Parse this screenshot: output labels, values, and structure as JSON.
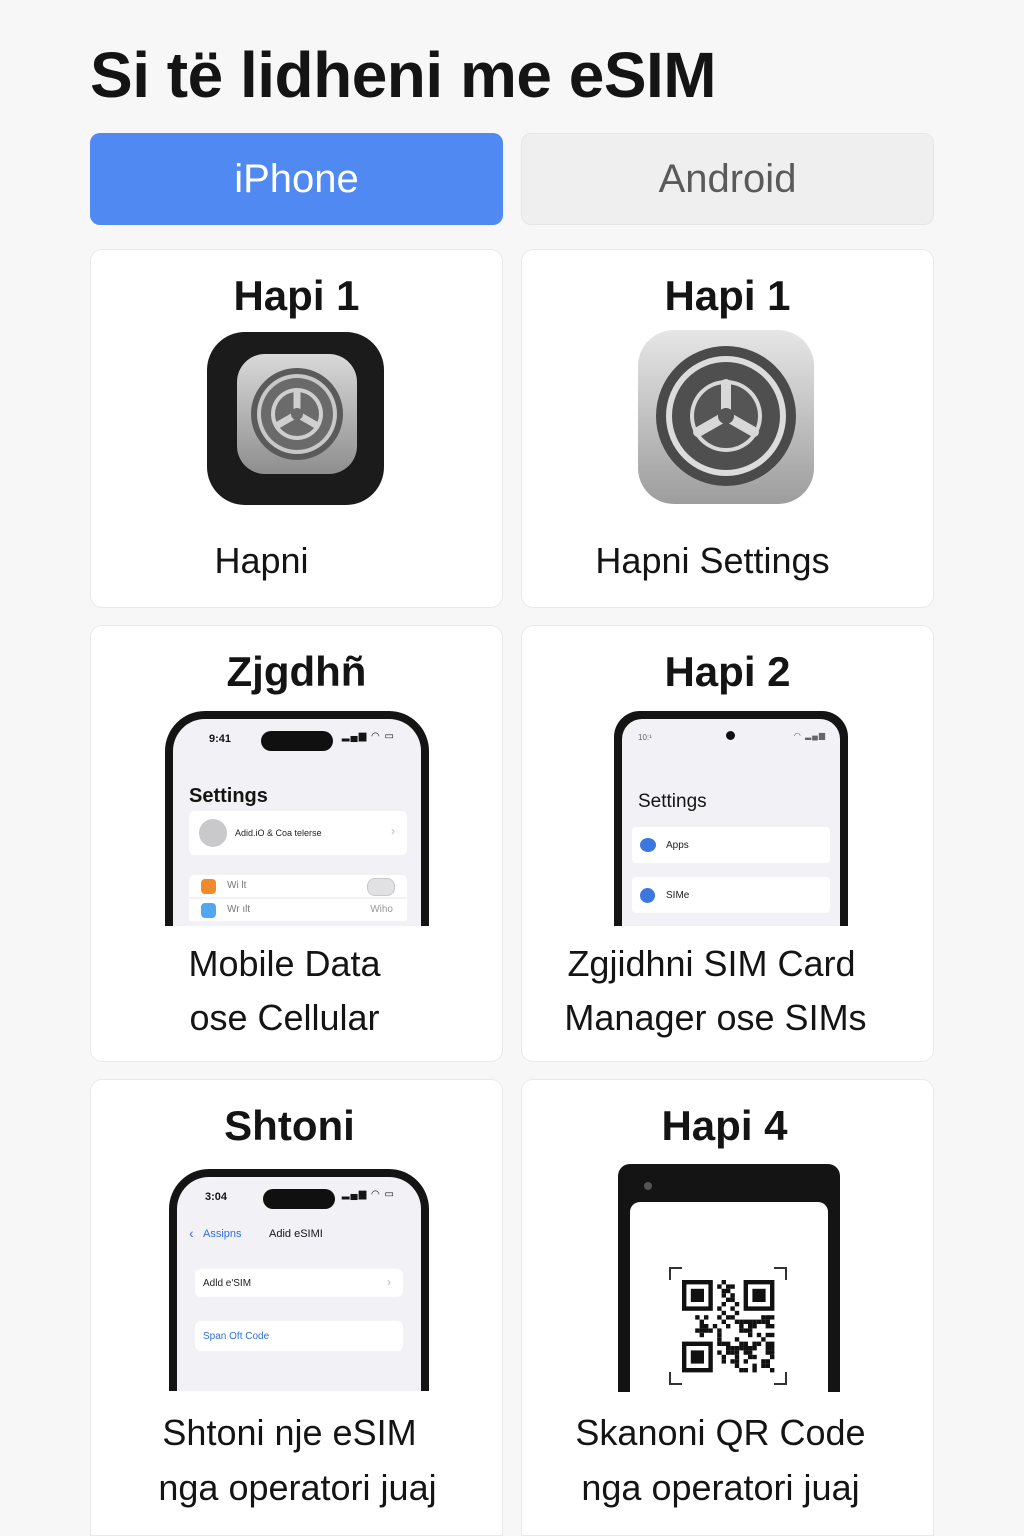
{
  "page": {
    "title": "Si të lidheni me eSIM"
  },
  "tabs": [
    {
      "label": "iPhone",
      "active": true
    },
    {
      "label": "Android",
      "active": false
    }
  ],
  "colors": {
    "accent": "#5189f2",
    "tab_inactive": "#efeff0",
    "background": "#f7f7f8",
    "card": "#ffffff"
  },
  "cards": {
    "iphone_step1": {
      "title": "Hapi 1",
      "icon": "settings-gear-icon",
      "text1": "Hapni"
    },
    "android_step1": {
      "title": "Hapi 1",
      "icon": "settings-gear-icon",
      "text1": "Hapni Settings"
    },
    "iphone_step2": {
      "title": "Zjgdhñ",
      "text1": "Mobile Data",
      "text2": "ose Cellular",
      "screen": {
        "time": "9:41",
        "heading": "Settings",
        "account_row": "Adid.iO & Coa telerse",
        "row1": "Wi lt",
        "row2": "Wr ılt",
        "row2_value": "Wiho"
      }
    },
    "android_step2": {
      "title": "Hapi 2",
      "text1": "Zgjidhni SIM Card",
      "text2": "Manager ose SIMs",
      "screen": {
        "time": "10:¹",
        "heading": "Settings",
        "row1": "Apps",
        "row2": "SIMe"
      }
    },
    "iphone_step3": {
      "title": "Shtoni",
      "text1": "Shtoni nje eSIM",
      "text2": "nga operatori juaj",
      "screen": {
        "time": "3:04",
        "back_label": "Assipns",
        "nav_title": "Adid eSIMI",
        "row1": "Adld e'SIM",
        "row2": "Span Oft Code"
      }
    },
    "android_step4": {
      "title": "Hapi 4",
      "text1": "Skanoni QR Code",
      "text2": "nga operatori juaj",
      "icon": "qr-code-icon"
    }
  }
}
